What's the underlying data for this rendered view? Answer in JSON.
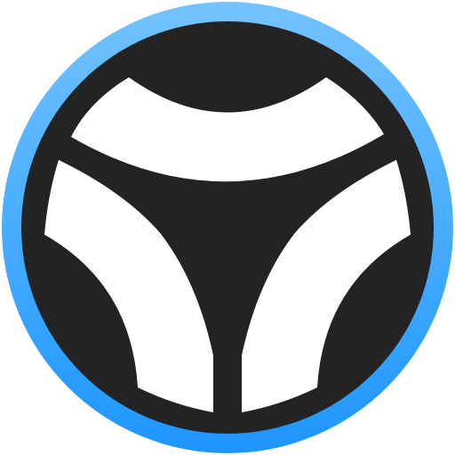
{
  "icon": {
    "name": "app-logo-icon",
    "ring_gradient_top": "#73C3FF",
    "ring_gradient_bottom": "#1E96FF",
    "disc_color": "#232323",
    "glyph_color": "#FFFFFF"
  }
}
